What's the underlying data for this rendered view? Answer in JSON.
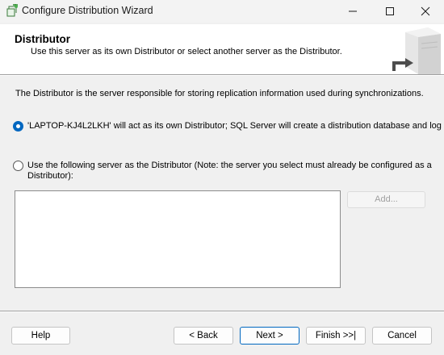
{
  "window": {
    "title": "Configure Distribution Wizard",
    "app_icon": "wizard-icon",
    "controls": [
      "minimize-icon",
      "maximize-icon",
      "close-icon"
    ]
  },
  "header": {
    "title": "Distributor",
    "subtitle": "Use this server as its own Distributor or select another server as the Distributor.",
    "art": "server-arrow-icon"
  },
  "main": {
    "description": "The Distributor is the server responsible for storing replication information used during synchronizations.",
    "option_own": {
      "label": "'LAPTOP-KJ4L2LKH' will act as its own Distributor; SQL Server will create a distribution database and log",
      "selected": true
    },
    "option_other": {
      "label_line1": "Use the following server as the Distributor (Note: the server you select must already be configured as a",
      "label_line2": "Distributor):",
      "selected": false
    },
    "server_list": [],
    "add_label": "Add..."
  },
  "footer": {
    "help": "Help",
    "back": "< Back",
    "next": "Next >",
    "finish": "Finish >>|",
    "cancel": "Cancel"
  },
  "colors": {
    "accent": "#0067c0",
    "dialog_bg": "#f0f0f0"
  }
}
